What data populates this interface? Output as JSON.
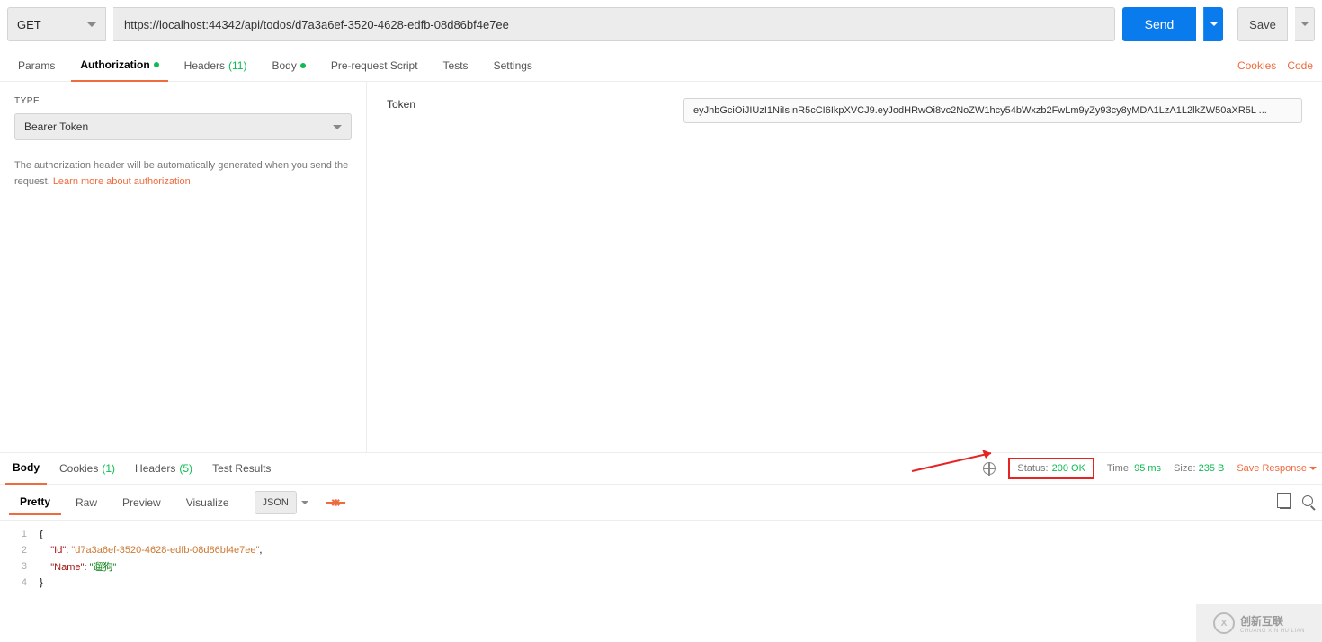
{
  "request": {
    "method": "GET",
    "url": "https://localhost:44342/api/todos/d7a3a6ef-3520-4628-edfb-08d86bf4e7ee",
    "send_label": "Send",
    "save_label": "Save"
  },
  "req_tabs": {
    "params": "Params",
    "authorization": "Authorization",
    "headers": "Headers",
    "headers_count": "(11)",
    "body": "Body",
    "prerequest": "Pre-request Script",
    "tests": "Tests",
    "settings": "Settings",
    "cookies": "Cookies",
    "code": "Code"
  },
  "auth": {
    "type_label": "TYPE",
    "type_value": "Bearer Token",
    "help_text": "The authorization header will be automatically generated when you send the request. ",
    "learn_more": "Learn more about authorization",
    "token_label": "Token",
    "token_value": "eyJhbGciOiJIUzI1NiIsInR5cCI6IkpXVCJ9.eyJodHRwOi8vc2NoZW1hcy54bWxzb2FwLm9yZy93cy8yMDA1LzA1L2lkZW50aXR5L ..."
  },
  "resp_tabs": {
    "body": "Body",
    "cookies": "Cookies",
    "cookies_count": "(1)",
    "headers": "Headers",
    "headers_count": "(5)",
    "test_results": "Test Results"
  },
  "response_meta": {
    "status_label": "Status:",
    "status_value": "200 OK",
    "time_label": "Time:",
    "time_value": "95 ms",
    "size_label": "Size:",
    "size_value": "235 B",
    "save_response": "Save Response"
  },
  "format": {
    "pretty": "Pretty",
    "raw": "Raw",
    "preview": "Preview",
    "visualize": "Visualize",
    "json": "JSON"
  },
  "response_body": {
    "line1": "{",
    "line2_key": "\"Id\"",
    "line2_val": "\"d7a3a6ef-3520-4628-edfb-08d86bf4e7ee\"",
    "line3_key": "\"Name\"",
    "line3_val": "\"遛狗\"",
    "line4": "}"
  },
  "watermark": {
    "brand": "创新互联",
    "sub": "CHUANG XIN HU LIAN"
  }
}
